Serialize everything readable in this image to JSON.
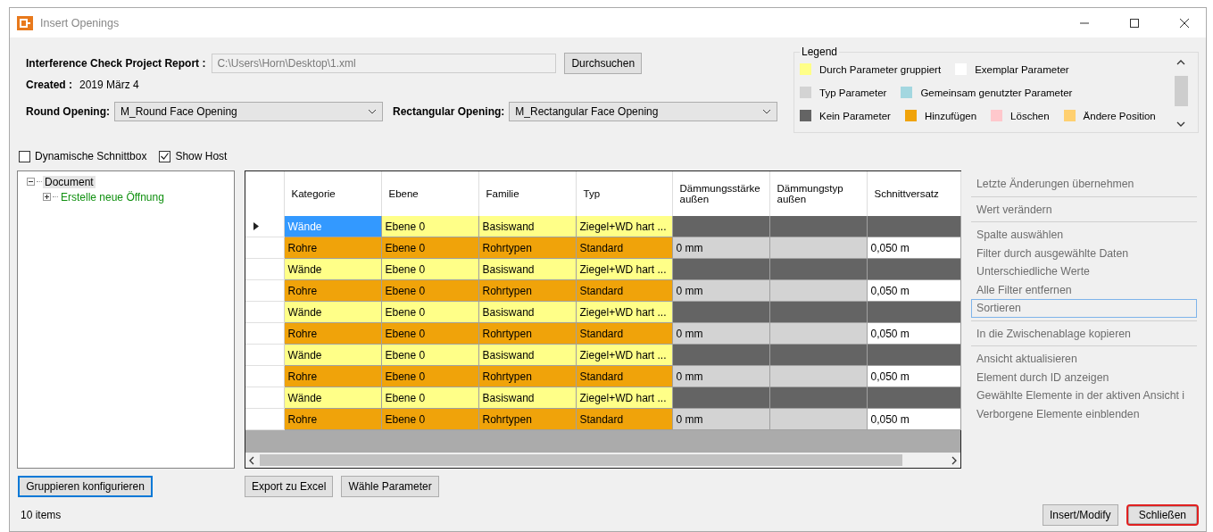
{
  "window": {
    "title": "Insert Openings"
  },
  "report": {
    "label": "Interference Check Project Report :",
    "path": "C:\\Users\\Horn\\Desktop\\1.xml",
    "browse": "Durchsuchen"
  },
  "created": {
    "label": "Created :",
    "value": "2019 März 4"
  },
  "openings": [
    {
      "label": "Round Opening:",
      "value": "M_Round Face Opening"
    },
    {
      "label": "Rectangular Opening:",
      "value": "M_Rectangular Face Opening"
    }
  ],
  "legend": {
    "title": "Legend",
    "rows": [
      [
        {
          "label": "Durch Parameter gruppiert",
          "color": "#ffff88"
        },
        {
          "label": "Exemplar Parameter",
          "color": "#ffffff"
        }
      ],
      [
        {
          "label": "Typ Parameter",
          "color": "#d3d3d3"
        },
        {
          "label": "Gemeinsam genutzter Parameter",
          "color": "#a3d7e0"
        }
      ],
      [
        {
          "label": "Kein Parameter",
          "color": "#646464"
        },
        {
          "label": "Hinzufügen",
          "color": "#f0a30a"
        },
        {
          "label": "Löschen",
          "color": "#ffc8cc"
        },
        {
          "label": "Ändere Position",
          "color": "#ffd070"
        }
      ]
    ]
  },
  "options": [
    {
      "label": "Dynamische Schnittbox",
      "checked": false
    },
    {
      "label": "Show Host",
      "checked": true
    }
  ],
  "tree": [
    {
      "label": "Document",
      "expanded": true,
      "selected": true,
      "color": "#000000",
      "children": [
        {
          "label": "Erstelle neue Öffnung",
          "expanded": false,
          "selected": false,
          "color": "#109010"
        }
      ]
    }
  ],
  "table": {
    "columns": [
      "Kategorie",
      "Ebene",
      "Familie",
      "Typ",
      "Dämmungsstärke außen",
      "Dämmungstyp außen",
      "Schnittversatz"
    ],
    "rows": [
      {
        "current": true,
        "cells": [
          {
            "text": "Wände",
            "selected": true
          },
          {
            "text": "Ebene 0",
            "color": "#ffff88",
            "selected": false
          },
          {
            "text": "Basiswand",
            "color": "#ffff88",
            "selected": false
          },
          {
            "text": "Ziegel+WD hart ...",
            "color": "#ffff88",
            "selected": false
          },
          {
            "color": "#646464",
            "selected": false
          },
          {
            "color": "#646464",
            "selected": false
          },
          {
            "color": "#646464",
            "selected": false
          }
        ]
      },
      {
        "current": false,
        "cells": [
          {
            "text": "Rohre",
            "color": "#f0a30a",
            "selected": false
          },
          {
            "text": "Ebene 0",
            "color": "#f0a30a",
            "selected": false
          },
          {
            "text": "Rohrtypen",
            "color": "#f0a30a",
            "selected": false
          },
          {
            "text": "Standard",
            "color": "#f0a30a",
            "selected": false
          },
          {
            "text": "0 mm",
            "color": "#d3d3d3",
            "selected": false
          },
          {
            "color": "#d3d3d3",
            "selected": false
          },
          {
            "text": "0,050 m",
            "color": "#ffffff",
            "selected": false
          }
        ]
      },
      {
        "current": false,
        "cells": [
          {
            "text": "Wände",
            "color": "#ffff88",
            "selected": false
          },
          {
            "text": "Ebene 0",
            "color": "#ffff88",
            "selected": false
          },
          {
            "text": "Basiswand",
            "color": "#ffff88",
            "selected": false
          },
          {
            "text": "Ziegel+WD hart ...",
            "color": "#ffff88",
            "selected": false
          },
          {
            "color": "#646464",
            "selected": false
          },
          {
            "color": "#646464",
            "selected": false
          },
          {
            "color": "#646464",
            "selected": false
          }
        ]
      },
      {
        "current": false,
        "cells": [
          {
            "text": "Rohre",
            "color": "#f0a30a",
            "selected": false
          },
          {
            "text": "Ebene 0",
            "color": "#f0a30a",
            "selected": false
          },
          {
            "text": "Rohrtypen",
            "color": "#f0a30a",
            "selected": false
          },
          {
            "text": "Standard",
            "color": "#f0a30a",
            "selected": false
          },
          {
            "text": "0 mm",
            "color": "#d3d3d3",
            "selected": false
          },
          {
            "color": "#d3d3d3",
            "selected": false
          },
          {
            "text": "0,050 m",
            "color": "#ffffff",
            "selected": false
          }
        ]
      },
      {
        "current": false,
        "cells": [
          {
            "text": "Wände",
            "color": "#ffff88",
            "selected": false
          },
          {
            "text": "Ebene 0",
            "color": "#ffff88",
            "selected": false
          },
          {
            "text": "Basiswand",
            "color": "#ffff88",
            "selected": false
          },
          {
            "text": "Ziegel+WD hart ...",
            "color": "#ffff88",
            "selected": false
          },
          {
            "color": "#646464",
            "selected": false
          },
          {
            "color": "#646464",
            "selected": false
          },
          {
            "color": "#646464",
            "selected": false
          }
        ]
      },
      {
        "current": false,
        "cells": [
          {
            "text": "Rohre",
            "color": "#f0a30a",
            "selected": false
          },
          {
            "text": "Ebene 0",
            "color": "#f0a30a",
            "selected": false
          },
          {
            "text": "Rohrtypen",
            "color": "#f0a30a",
            "selected": false
          },
          {
            "text": "Standard",
            "color": "#f0a30a",
            "selected": false
          },
          {
            "text": "0 mm",
            "color": "#d3d3d3",
            "selected": false
          },
          {
            "color": "#d3d3d3",
            "selected": false
          },
          {
            "text": "0,050 m",
            "color": "#ffffff",
            "selected": false
          }
        ]
      },
      {
        "current": false,
        "cells": [
          {
            "text": "Wände",
            "color": "#ffff88",
            "selected": false
          },
          {
            "text": "Ebene 0",
            "color": "#ffff88",
            "selected": false
          },
          {
            "text": "Basiswand",
            "color": "#ffff88",
            "selected": false
          },
          {
            "text": "Ziegel+WD hart ...",
            "color": "#ffff88",
            "selected": false
          },
          {
            "color": "#646464",
            "selected": false
          },
          {
            "color": "#646464",
            "selected": false
          },
          {
            "color": "#646464",
            "selected": false
          }
        ]
      },
      {
        "current": false,
        "cells": [
          {
            "text": "Rohre",
            "color": "#f0a30a",
            "selected": false
          },
          {
            "text": "Ebene 0",
            "color": "#f0a30a",
            "selected": false
          },
          {
            "text": "Rohrtypen",
            "color": "#f0a30a",
            "selected": false
          },
          {
            "text": "Standard",
            "color": "#f0a30a",
            "selected": false
          },
          {
            "text": "0 mm",
            "color": "#d3d3d3",
            "selected": false
          },
          {
            "color": "#d3d3d3",
            "selected": false
          },
          {
            "text": "0,050 m",
            "color": "#ffffff",
            "selected": false
          }
        ]
      },
      {
        "current": false,
        "cells": [
          {
            "text": "Wände",
            "color": "#ffff88",
            "selected": false
          },
          {
            "text": "Ebene 0",
            "color": "#ffff88",
            "selected": false
          },
          {
            "text": "Basiswand",
            "color": "#ffff88",
            "selected": false
          },
          {
            "text": "Ziegel+WD hart ...",
            "color": "#ffff88",
            "selected": false
          },
          {
            "color": "#646464",
            "selected": false
          },
          {
            "color": "#646464",
            "selected": false
          },
          {
            "color": "#646464",
            "selected": false
          }
        ]
      },
      {
        "current": false,
        "cells": [
          {
            "text": "Rohre",
            "color": "#f0a30a",
            "selected": false
          },
          {
            "text": "Ebene 0",
            "color": "#f0a30a",
            "selected": false
          },
          {
            "text": "Rohrtypen",
            "color": "#f0a30a",
            "selected": false
          },
          {
            "text": "Standard",
            "color": "#f0a30a",
            "selected": false
          },
          {
            "text": "0 mm",
            "color": "#d3d3d3",
            "selected": false
          },
          {
            "color": "#d3d3d3",
            "selected": false
          },
          {
            "text": "0,050 m",
            "color": "#ffffff",
            "selected": false
          }
        ]
      }
    ]
  },
  "actions": [
    [
      {
        "label": "Letzte Änderungen übernehmen",
        "disabled": true,
        "focused": false
      }
    ],
    [
      {
        "label": "Wert verändern",
        "disabled": true,
        "focused": false
      }
    ],
    [
      {
        "label": "Spalte auswählen",
        "disabled": true,
        "focused": false
      },
      {
        "label": "Filter durch ausgewählte Daten",
        "disabled": true,
        "focused": false
      },
      {
        "label": "Unterschiedliche Werte",
        "disabled": true,
        "focused": false
      },
      {
        "label": "Alle Filter entfernen",
        "disabled": true,
        "focused": false
      },
      {
        "label": "Sortieren",
        "disabled": true,
        "focused": true
      }
    ],
    [
      {
        "label": "In die Zwischenablage kopieren",
        "disabled": true,
        "focused": false
      }
    ],
    [
      {
        "label": "Ansicht aktualisieren",
        "disabled": true,
        "focused": false
      },
      {
        "label": "Element durch ID anzeigen",
        "disabled": true,
        "focused": false
      },
      {
        "label": "Gewählte Elemente in der aktiven Ansicht i",
        "disabled": true,
        "focused": false
      },
      {
        "label": "Verborgene Elemente einblenden",
        "disabled": true,
        "focused": false
      }
    ]
  ],
  "group_button": {
    "label": "Gruppieren konfigurieren",
    "focused": true
  },
  "table_buttons": [
    "Export zu Excel",
    "Wähle Parameter"
  ],
  "status_bar": {
    "text": "10 items"
  },
  "dialog_buttons": [
    {
      "label": "Insert/Modify",
      "highlighted": false
    },
    {
      "label": "Schließen",
      "highlighted": true
    }
  ]
}
